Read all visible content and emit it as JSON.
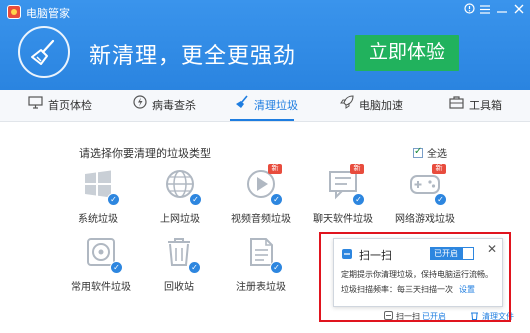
{
  "window": {
    "title": "电脑管家"
  },
  "header": {
    "slogan": "新清理，更全更强劲",
    "try_button": "立即体验"
  },
  "nav": {
    "items": [
      {
        "label": "首页体检",
        "icon": "monitor-icon"
      },
      {
        "label": "病毒查杀",
        "icon": "lightning-shield-icon"
      },
      {
        "label": "清理垃圾",
        "icon": "broom-icon",
        "active": true
      },
      {
        "label": "电脑加速",
        "icon": "rocket-icon"
      },
      {
        "label": "工具箱",
        "icon": "toolbox-icon"
      }
    ]
  },
  "content": {
    "section_label": "请选择你要清理的垃圾类型",
    "select_all": "全选",
    "new_badge": "新",
    "tiles": [
      {
        "label": "系统垃圾",
        "icon": "windows-icon",
        "checked": true
      },
      {
        "label": "上网垃圾",
        "icon": "globe-icon",
        "checked": true
      },
      {
        "label": "视频音频垃圾",
        "icon": "video-icon",
        "checked": true,
        "new": true
      },
      {
        "label": "聊天软件垃圾",
        "icon": "chat-icon",
        "checked": true,
        "new": true
      },
      {
        "label": "网络游戏垃圾",
        "icon": "gamepad-icon",
        "checked": true,
        "new": true
      },
      {
        "label": "常用软件垃圾",
        "icon": "disc-icon",
        "checked": true
      },
      {
        "label": "回收站",
        "icon": "recycle-bin-icon",
        "checked": true
      },
      {
        "label": "注册表垃圾",
        "icon": "registry-icon",
        "checked": true
      }
    ]
  },
  "popup": {
    "title": "扫一扫",
    "toggle": "已开启",
    "description": "定期提示你清理垃圾，保持电脑运行流畅。",
    "frequency": "垃圾扫描频率：每三天扫描一次",
    "settings_link": "设置"
  },
  "status": {
    "scan_label": "扫一扫",
    "scan_state": "已开启",
    "clean_files": "清理文件"
  },
  "colors": {
    "header_blue": "#2e8ae6",
    "accent_blue": "#1e7de0",
    "try_green": "#21b25d",
    "highlight_red": "#e0141e"
  }
}
